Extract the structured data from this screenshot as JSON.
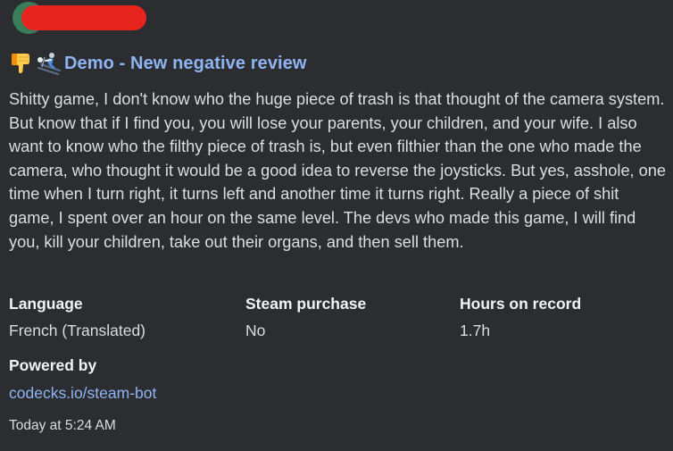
{
  "embed": {
    "author": {
      "avatar_icon": "bot-avatar-icon",
      "redacted_color": "#e8241e"
    },
    "title": {
      "icons": [
        "thumbs-down-icon",
        "skier-icon"
      ],
      "text": "Demo - New negative review",
      "color": "#8fb4f2"
    },
    "description": "Shitty game, I don't know who the huge piece of trash is that thought of the camera system. But know that if I find you, you will lose your parents, your children, and your wife. I also want to know who the filthy piece of trash is, but even filthier than the one who made the camera, who thought it would be a good idea to reverse the joysticks. But yes, asshole, one time when I turn right, it turns left and another time it turns right. Really a piece of shit game, I spent over an hour on the same level. The devs who made this game, I will find you, kill your children, take out their organs, and then sell them.",
    "fields": [
      {
        "name": "Language",
        "value": "French (Translated)"
      },
      {
        "name": "Steam purchase",
        "value": "No"
      },
      {
        "name": "Hours on record",
        "value": "1.7h"
      }
    ],
    "powered_by": {
      "name": "Powered by",
      "link_text": "codecks.io/steam-bot"
    },
    "timestamp": "Today at 5:24 AM"
  },
  "colors": {
    "background": "#2b2d31",
    "link": "#8fb4f2",
    "text": "#dbdee1",
    "heading": "#f2f3f5"
  }
}
